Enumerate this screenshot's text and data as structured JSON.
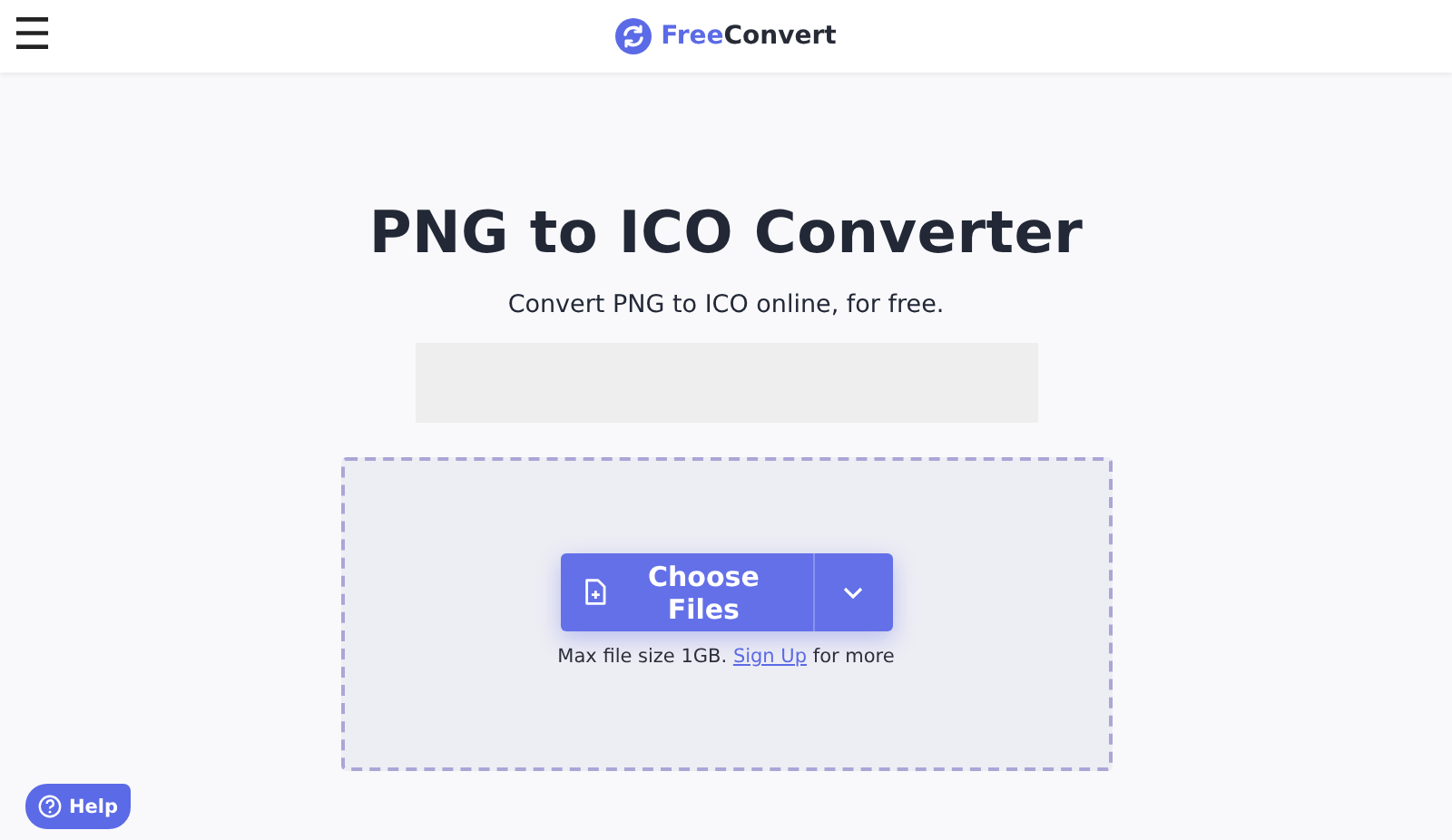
{
  "header": {
    "menu_icon": "☰",
    "logo": {
      "part_1": "Free",
      "part_2": "Convert"
    }
  },
  "hero": {
    "title": "PNG to ICO Converter",
    "subtitle": "Convert PNG to ICO online, for free."
  },
  "ad_slot": {
    "kind": "placeholder"
  },
  "upload": {
    "button": "Choose Files",
    "note": {
      "before": "Max file size 1GB.",
      "link": "Sign Up",
      "after": "for more"
    }
  },
  "help_button": "Help"
}
